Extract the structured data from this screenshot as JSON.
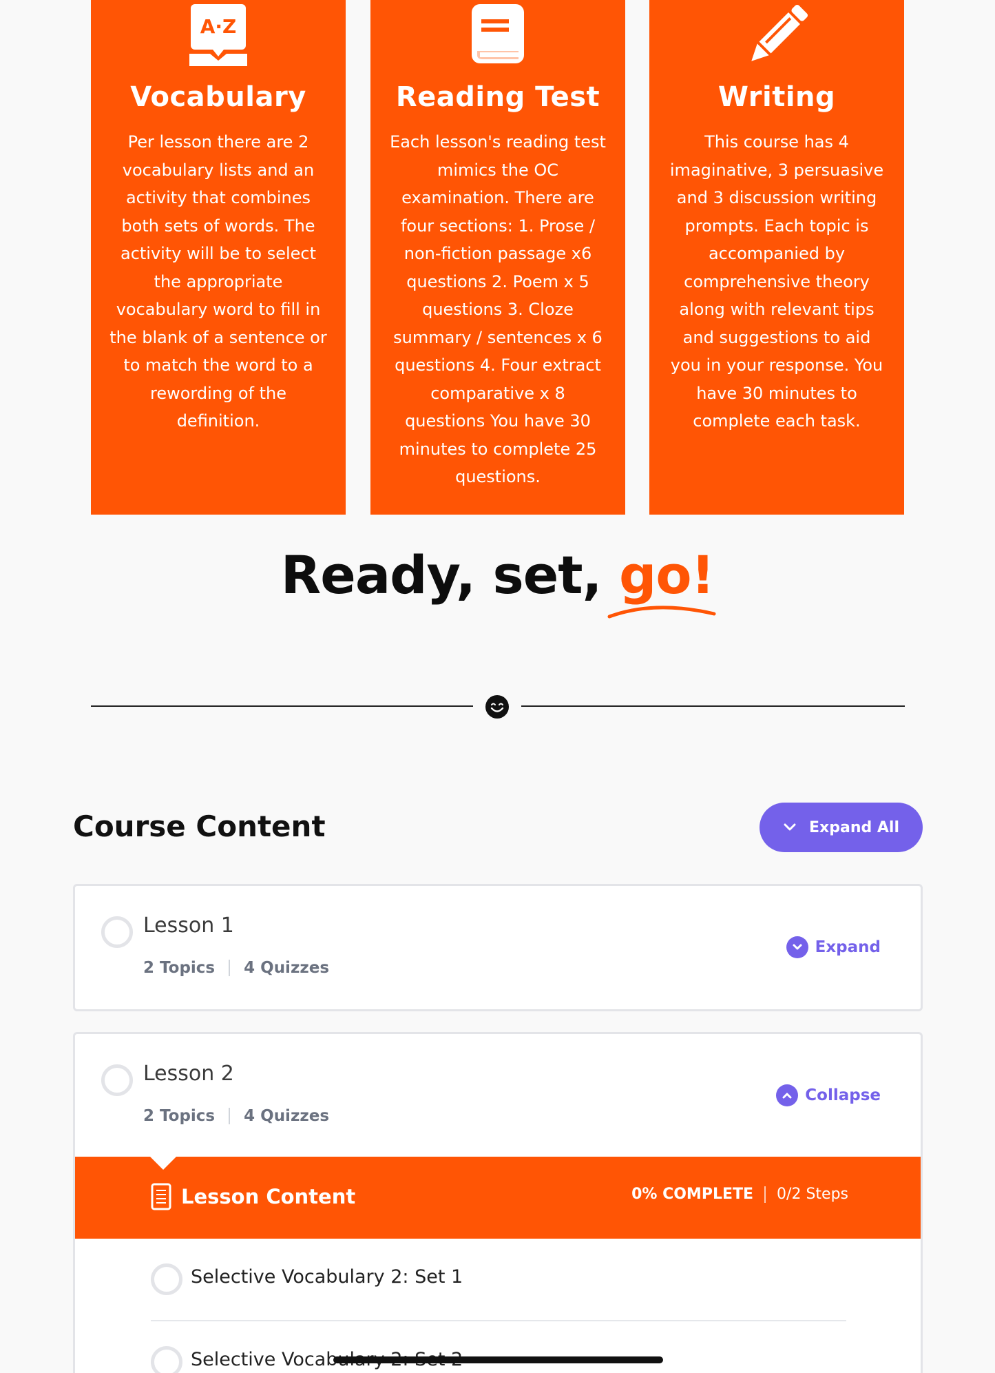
{
  "colors": {
    "accent": "#ff5505",
    "purple": "#7461ea",
    "background": "#f9f9f9"
  },
  "cards": [
    {
      "icon": "a-z-book-icon",
      "title": "Vocabulary",
      "text": "Per lesson there are 2 vocabulary lists and an activity that combines both sets of words. The activity will be to select the appropriate vocabulary word to fill in the blank of a sentence or to match the word to a rewording of the definition."
    },
    {
      "icon": "book-icon",
      "title": "Reading Test",
      "text": "Each lesson's reading test mimics the OC examination. There are four sections: 1. Prose / non-fiction passage x6 questions 2. Poem x 5 questions 3. Cloze summary / sentences x 6 questions 4. Four extract comparative x 8 questions You have 30 minutes to complete 25 questions."
    },
    {
      "icon": "pencil-icon",
      "title": "Writing",
      "text": "This course has 4 imaginative, 3 persuasive and 3 discussion writing prompts. Each topic is accompanied by comprehensive theory along with relevant tips and suggestions to aid you in your response. You have 30 minutes to complete each task."
    }
  ],
  "hero": {
    "title_main": "Ready, set, ",
    "title_accent": "go!"
  },
  "divider": {
    "icon": "smile-icon"
  },
  "course": {
    "title": "Course Content",
    "expand_all_label": "Expand All",
    "lessons": [
      {
        "title": "Lesson 1",
        "topics": "2 Topics",
        "quizzes": "4 Quizzes",
        "toggle_label": "Expand"
      },
      {
        "title": "Lesson 2",
        "topics": "2 Topics",
        "quizzes": "4 Quizzes",
        "toggle_label": "Collapse",
        "content": {
          "label": "Lesson Content",
          "percent": "0% COMPLETE",
          "steps_count": "0/2 Steps",
          "steps": [
            "Selective Vocabulary 2: Set 1",
            "Selective Vocabulary 2: Set 2"
          ]
        }
      }
    ]
  }
}
